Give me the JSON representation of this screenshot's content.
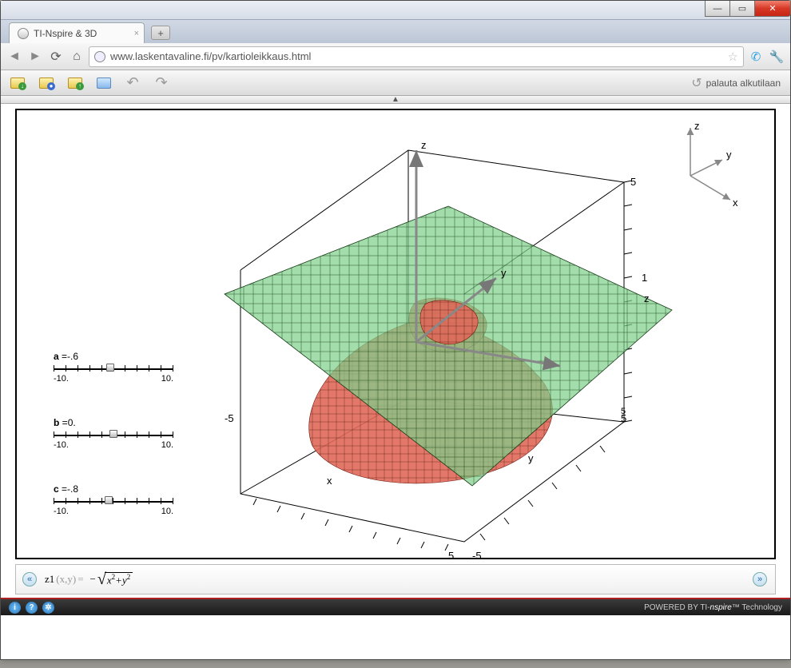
{
  "browser": {
    "tab_title": "TI-Nspire & 3D",
    "url": "www.laskentavaline.fi/pv/kartioleikkaus.html"
  },
  "app_toolbar": {
    "reset_label": "palauta alkutilaan"
  },
  "sliders": {
    "a": {
      "name": "a",
      "value": "-.6",
      "min": "-10.",
      "max": "10.",
      "pos_pct": 47
    },
    "b": {
      "name": "b",
      "value": "0.",
      "min": "-10.",
      "max": "10.",
      "pos_pct": 50
    },
    "c": {
      "name": "c",
      "value": "-.8",
      "min": "-10.",
      "max": "10.",
      "pos_pct": 46
    }
  },
  "axes": {
    "x": "x",
    "y": "y",
    "z": "z",
    "range": {
      "min": "-5",
      "max": "5",
      "zmark": "1"
    }
  },
  "formula": {
    "fn": "z1",
    "args": "(x,y)",
    "eq": "=",
    "neg": "−",
    "radicand": "x²+y²"
  },
  "footer": {
    "powered": "POWERED BY",
    "brand1": "TI-",
    "brand2": "nspire",
    "brand3": "™ Technology"
  },
  "chart_data": {
    "type": "3d_surface",
    "surfaces": [
      {
        "name": "cone",
        "formula": "z = -sqrt(x^2 + y^2)",
        "color": "#e05a4a"
      },
      {
        "name": "plane",
        "formula": "z = a*x + b*y + c",
        "a": -0.6,
        "b": 0.0,
        "c": -0.8,
        "color": "#6fc97a"
      }
    ],
    "xlim": [
      -5,
      5
    ],
    "ylim": [
      -5,
      5
    ],
    "zlim": [
      -5,
      5
    ],
    "z_tick_shown": 1
  }
}
